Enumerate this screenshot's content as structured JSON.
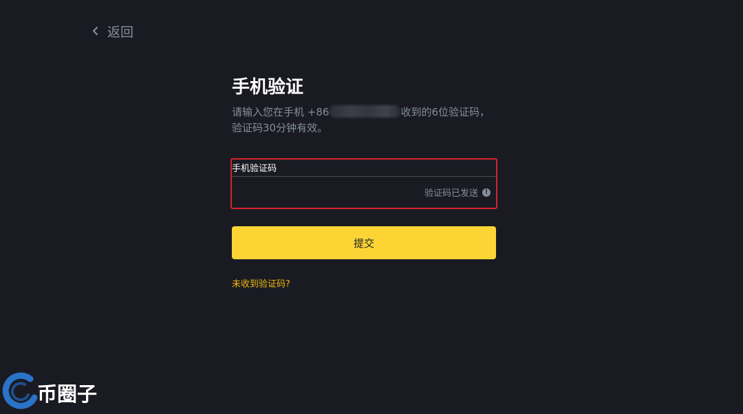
{
  "back": {
    "icon": "chevron-left-icon",
    "label": "返回"
  },
  "verify": {
    "title": "手机验证",
    "desc_prefix": "请输入您在手机 +86",
    "desc_suffix": "收到的6位验证码，",
    "desc_line2": "验证码30分钟有效。",
    "field_label": "手机验证码",
    "code_value": "",
    "code_placeholder": "",
    "sent_status": "验证码已发送",
    "status_icon": "info-icon",
    "submit_label": "提交",
    "resend_link": "未收到验证码?"
  },
  "watermark": {
    "text": "币圈子",
    "icon": "coin-circle-logo"
  },
  "colors": {
    "background": "#1a1b22",
    "accent": "#fcd535",
    "link": "#f0b90b",
    "highlight_border": "#d8232a",
    "muted_text": "#848e9c"
  }
}
